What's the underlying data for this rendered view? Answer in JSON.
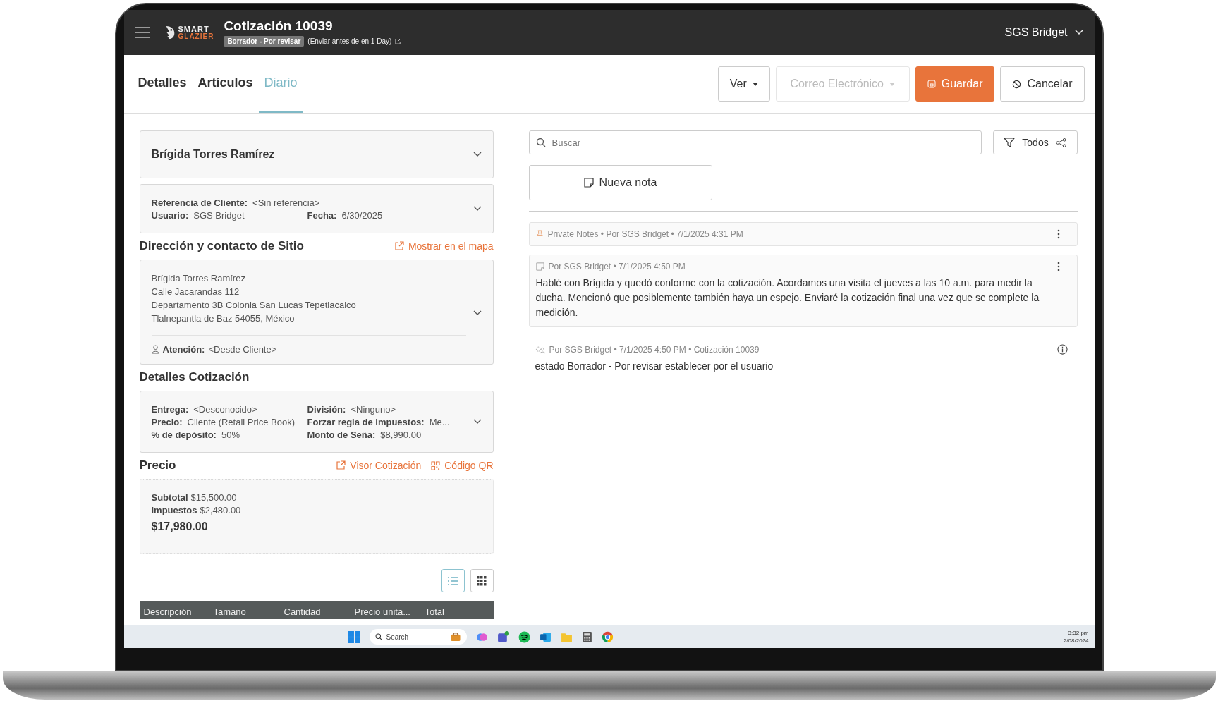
{
  "header": {
    "logo_top": "SMART",
    "logo_bottom": "GLAZIER",
    "title": "Cotización 10039",
    "status": "Borrador - Por revisar",
    "send_hint": "(Enviar antes de en 1 Day)",
    "user": "SGS Bridget"
  },
  "tabs": [
    {
      "label": "Detalles",
      "selected": false
    },
    {
      "label": "Artículos",
      "selected": false
    },
    {
      "label": "Diario",
      "selected": true
    }
  ],
  "actions": [
    {
      "kind": "dropdown",
      "label": "Ver",
      "disabled": false
    },
    {
      "kind": "dropdown",
      "label": "Correo Electrónico",
      "disabled": true
    },
    {
      "kind": "save",
      "label": "Guardar",
      "disabled": false
    },
    {
      "kind": "cancel",
      "label": "Cancelar",
      "disabled": false
    }
  ],
  "customer": {
    "name": "Brígida Torres Ramírez"
  },
  "reference": {
    "rows": [
      [
        {
          "label": "Referencia de Cliente:",
          "value": "<Sin referencia>"
        }
      ],
      [
        {
          "label": "Usuario:",
          "value": "SGS Bridget"
        },
        {
          "label": "Fecha:",
          "value": "6/30/2025"
        }
      ]
    ]
  },
  "site": {
    "heading": "Dirección y contacto de Sitio",
    "map_link": "Mostrar en el mapa",
    "address_lines": [
      "Brígida Torres Ramírez",
      "Calle Jacarandas 112",
      "Departamento 3B Colonia San Lucas Tepetlacalco",
      "Tlalnepantla de Baz 54055, México"
    ],
    "attention_label": "Atención:",
    "attention_value": "<Desde Cliente>"
  },
  "quote_details": {
    "heading": "Detalles Cotización",
    "rows": [
      [
        {
          "label": "Entrega:",
          "value": "<Desconocido>"
        },
        {
          "label": "División:",
          "value": "<Ninguno>"
        }
      ],
      [
        {
          "label": "Precio:",
          "value": "Cliente (Retail Price Book)"
        },
        {
          "label": "Forzar regla de impuestos:",
          "value": "Me..."
        }
      ],
      [
        {
          "label": "% de depósito:",
          "value": "50%"
        },
        {
          "label": "Monto de Seña:",
          "value": "$8,990.00"
        }
      ]
    ]
  },
  "price": {
    "heading": "Precio",
    "links": [
      {
        "kind": "viewer",
        "label": "Visor Cotización"
      },
      {
        "kind": "qr",
        "label": "Código QR"
      }
    ],
    "subtotal_label": "Subtotal",
    "subtotal": "$15,500.00",
    "tax_label": "Impuestos",
    "tax": "$2,480.00",
    "total": "$17,980.00"
  },
  "view_toggle": [
    {
      "kind": "list",
      "selected": true
    },
    {
      "kind": "grid",
      "selected": false
    }
  ],
  "table": {
    "columns": [
      "Descripción",
      "Tamaño",
      "Cantidad",
      "Precio unita...",
      "Total"
    ]
  },
  "journal": {
    "search_placeholder": "Buscar",
    "filter": "Todos",
    "new_note": "Nueva nota",
    "entries": [
      {
        "kind": "pinned",
        "meta": "Private Notes • Por SGS Bridget • 7/1/2025 4:31 PM"
      },
      {
        "kind": "note",
        "meta": "Por SGS Bridget • 7/1/2025 4:50 PM",
        "body": "Hablé con Brígida y quedó conforme con la cotización. Acordamos una visita el jueves a las 10 a.m. para medir la ducha. Mencionó que posiblemente también haya un espejo. Enviaré la cotización final una vez que se complete la medición."
      },
      {
        "kind": "system",
        "meta": "Por SGS Bridget • 7/1/2025 4:50 PM • Cotización 10039",
        "body": "estado Borrador - Por revisar establecer por el usuario"
      }
    ]
  },
  "taskbar": {
    "search_placeholder": "Search",
    "time": "3:32 pm",
    "date": "2/08/2024"
  }
}
